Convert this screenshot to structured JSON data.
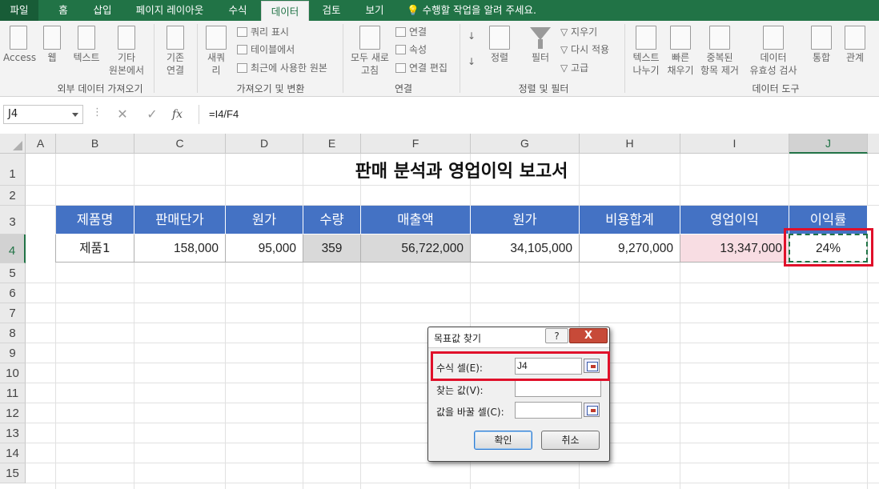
{
  "tabs": {
    "file": "파일",
    "home": "홈",
    "insert": "삽입",
    "page_layout": "페이지 레이아웃",
    "formulas": "수식",
    "data": "데이터",
    "review": "검토",
    "view": "보기",
    "tell_me": "수행할 작업을 알려 주세요."
  },
  "ribbon": {
    "access": "Access",
    "web": "웹",
    "text": "텍스트",
    "other_1": "기타",
    "other_2": "원본에서",
    "existing_1": "기존",
    "existing_2": "연결",
    "new_query_1": "새쿼",
    "new_query_2": "리",
    "show_queries": "쿼리 표시",
    "from_table": "테이블에서",
    "recent_sources": "최근에 사용한 원본",
    "refresh_1": "모두 새로",
    "refresh_2": "고침",
    "connections": "연결",
    "properties": "속성",
    "edit_links": "연결 편집",
    "sort": "정렬",
    "filter": "필터",
    "clear": "지우기",
    "reapply": "다시 적용",
    "advanced": "고급",
    "text_to_col_1": "텍스트",
    "text_to_col_2": "나누기",
    "flash_fill_1": "빠른",
    "flash_fill_2": "채우기",
    "remove_dup_1": "중복된",
    "remove_dup_2": "항목 제거",
    "validation_1": "데이터",
    "validation_2": "유효성 검사",
    "consolidate": "통합",
    "relations": "관계",
    "group_external": "외부 데이터 가져오기",
    "group_transform": "가져오기 및 변환",
    "group_connections": "연결",
    "group_sortfilter": "정렬 및 필터",
    "group_datatools": "데이터 도구"
  },
  "formula_bar": {
    "name_box": "J4",
    "formula": "=I4/F4"
  },
  "columns": [
    "A",
    "B",
    "C",
    "D",
    "E",
    "F",
    "G",
    "H",
    "I",
    "J"
  ],
  "rows": [
    "1",
    "2",
    "3",
    "4",
    "5",
    "6",
    "7",
    "8",
    "9",
    "10",
    "11",
    "12",
    "13",
    "14",
    "15"
  ],
  "sheet": {
    "title": "판매 분석과 영업이익 보고서",
    "headers": [
      "제품명",
      "판매단가",
      "원가",
      "수량",
      "매출액",
      "원가",
      "비용합계",
      "영업이익",
      "이익률"
    ],
    "row4": [
      "제품1",
      "158,000",
      "95,000",
      "359",
      "56,722,000",
      "34,105,000",
      "9,270,000",
      "13,347,000",
      "24%"
    ]
  },
  "dialog": {
    "title": "목표값 찾기",
    "help": "?",
    "close": "X",
    "formula_cell_label": "수식 셀(E):",
    "formula_cell_value": "J4",
    "target_value_label": "찾는 값(V):",
    "target_value_value": "",
    "changing_cell_label": "값을 바꿀 셀(C):",
    "changing_cell_value": "",
    "ok": "확인",
    "cancel": "취소"
  },
  "colors": {
    "excel_green": "#217346",
    "header_blue": "#4472c4",
    "highlight_red": "#e0102a",
    "profit_pink": "#f8dde3",
    "input_grey": "#d9d9d9"
  }
}
